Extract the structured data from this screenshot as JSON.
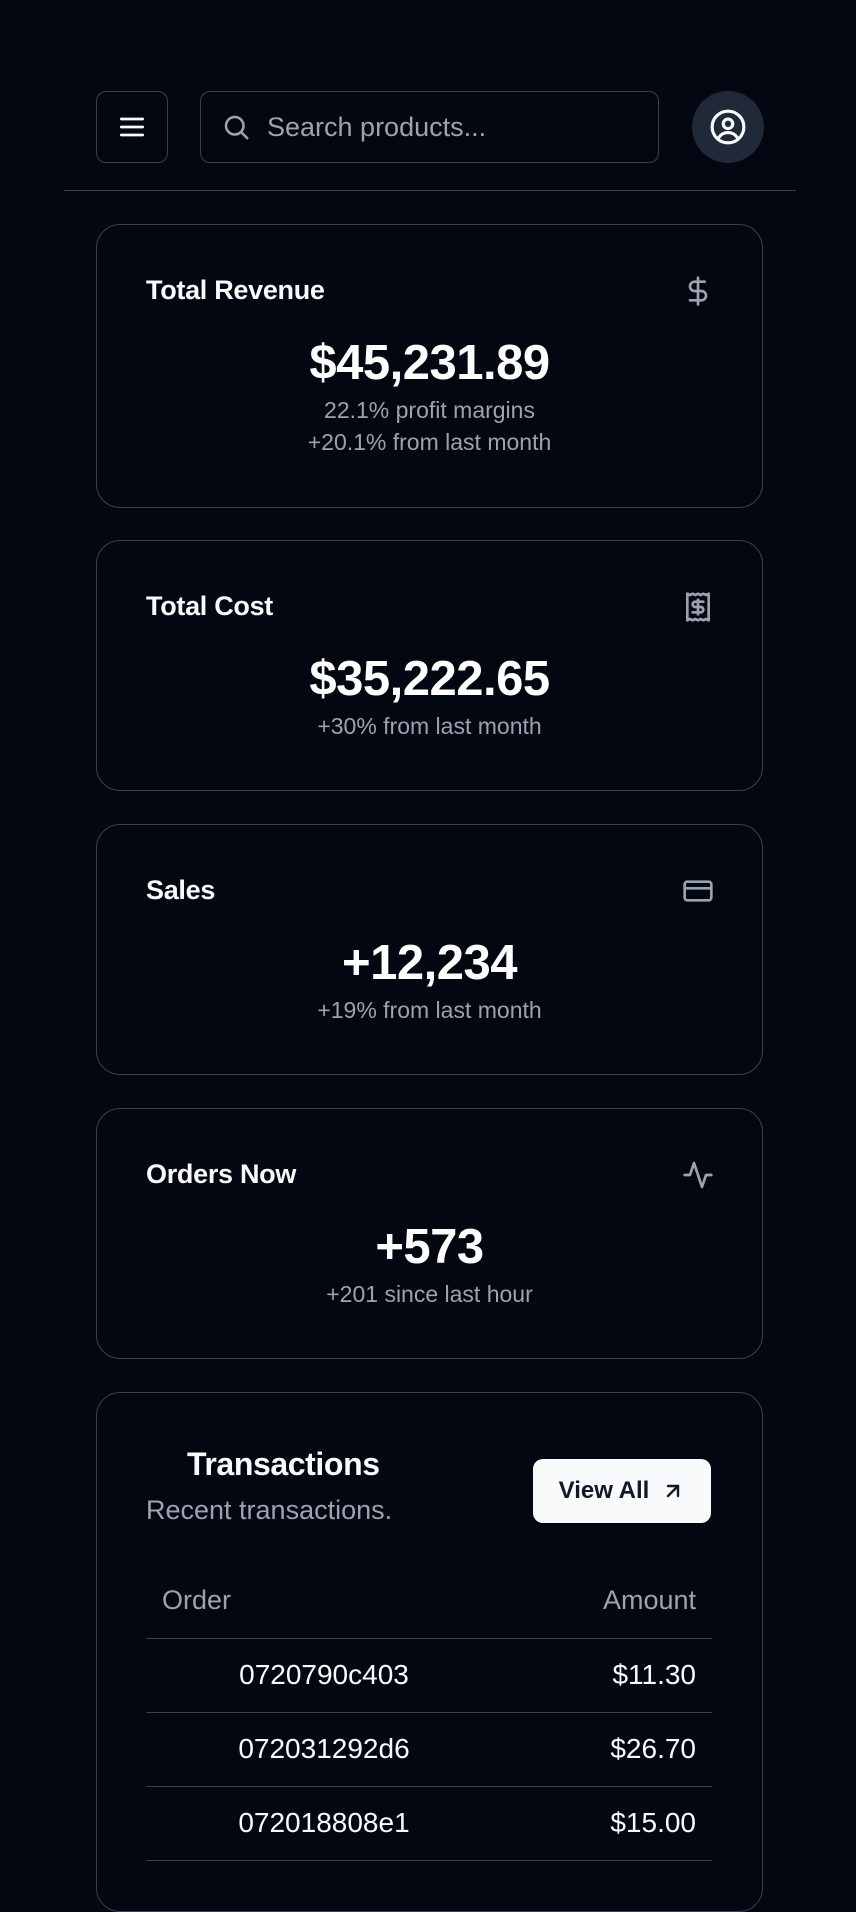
{
  "header": {
    "search_placeholder": "Search products..."
  },
  "cards": [
    {
      "title": "Total Revenue",
      "value": "$45,231.89",
      "sub1": "22.1% profit margins",
      "sub2": "+20.1% from last month",
      "icon": "dollar-sign-icon"
    },
    {
      "title": "Total Cost",
      "value": "$35,222.65",
      "sub1": "+30% from last month",
      "icon": "receipt-icon"
    },
    {
      "title": "Sales",
      "value": "+12,234",
      "sub1": "+19% from last month",
      "icon": "credit-card-icon"
    },
    {
      "title": "Orders Now",
      "value": "+573",
      "sub1": "+201 since last hour",
      "icon": "activity-icon"
    }
  ],
  "transactions": {
    "title": "Transactions",
    "description": "Recent transactions.",
    "view_all_label": "View All",
    "columns": [
      "Order",
      "Amount"
    ],
    "rows": [
      {
        "order": "0720790c403",
        "amount": "$11.30"
      },
      {
        "order": "072031292d6",
        "amount": "$26.70"
      },
      {
        "order": "072018808e1",
        "amount": "$15.00"
      }
    ]
  }
}
